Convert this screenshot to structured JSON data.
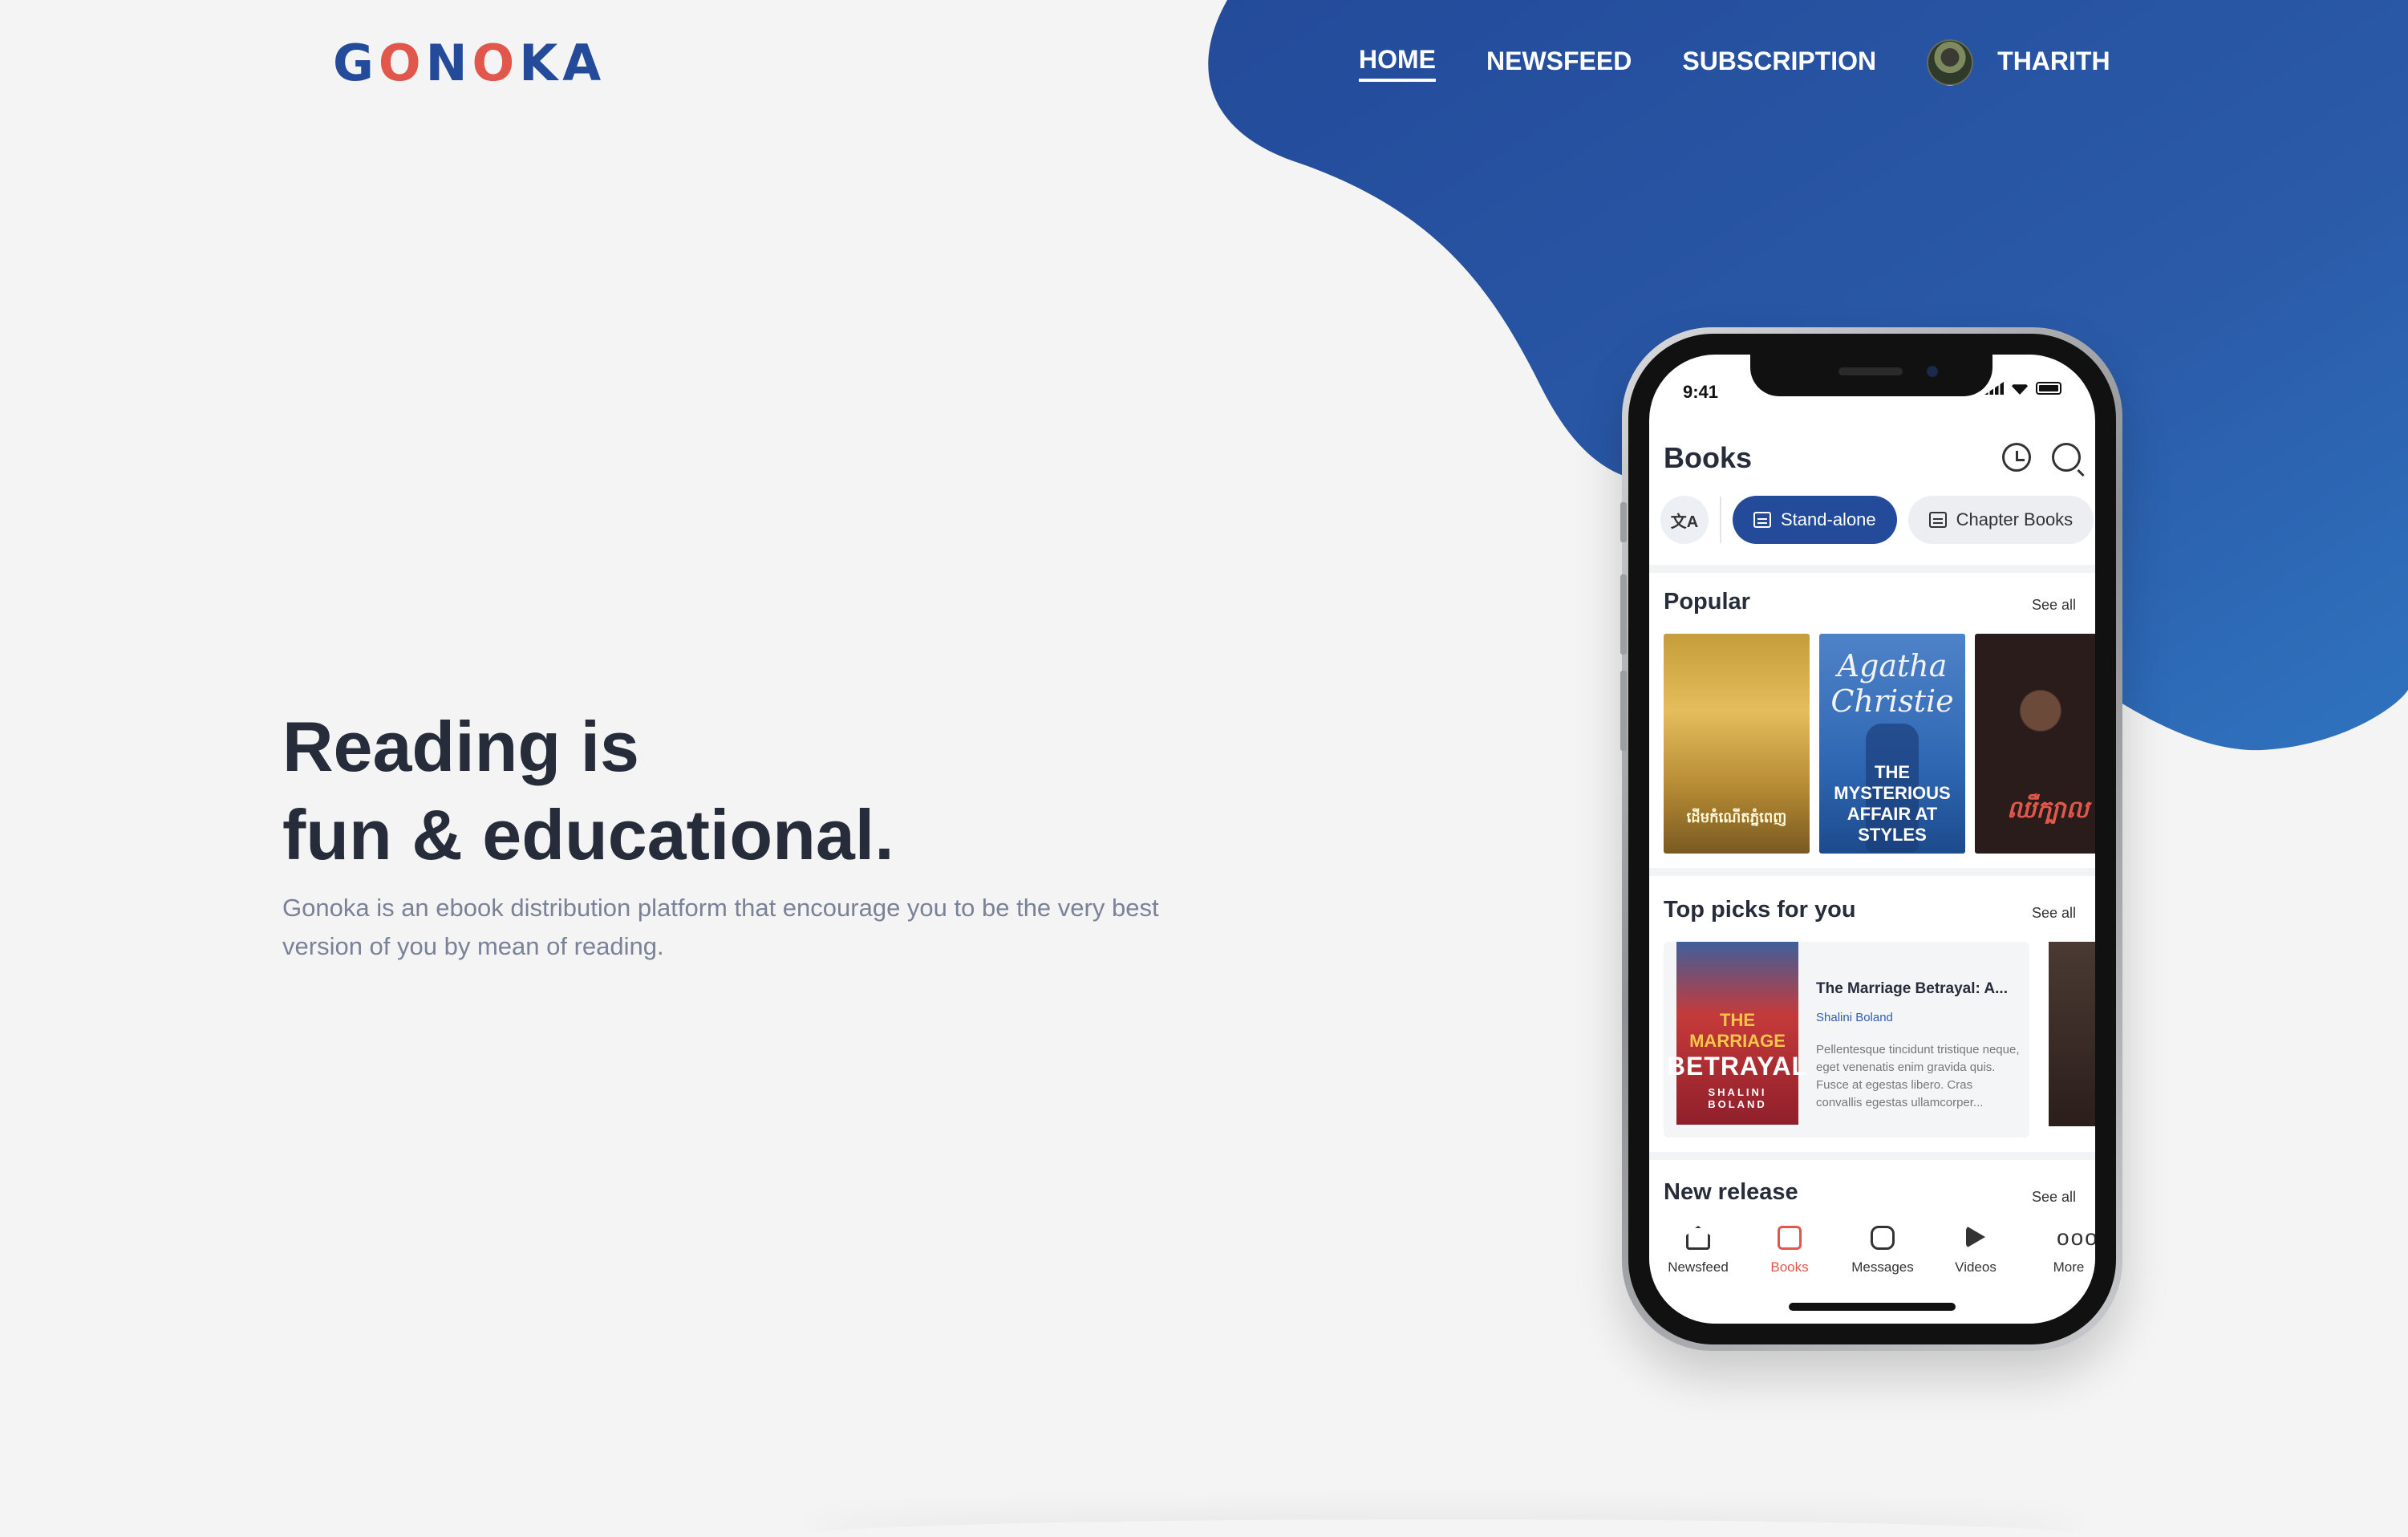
{
  "brand": {
    "logo": [
      "G",
      "O",
      "N",
      "O",
      "K",
      "A"
    ],
    "colors": {
      "primary": "#234b9a",
      "accent": "#e2574c",
      "background": "#f4f4f4",
      "text": "#262c3a",
      "muted": "#7a8297"
    }
  },
  "nav": {
    "home": "HOME",
    "newsfeed": "NEWSFEED",
    "subscription": "SUBSCRIPTION",
    "user_name": "THARITH",
    "user_avatar_icon": "avatar-photo"
  },
  "hero": {
    "title_line1": "Reading is",
    "title_line2": "fun & educational.",
    "description": "Gonoka is an ebook distribution platform that encourage you to be the very best version of you by mean of reading."
  },
  "phone": {
    "status": {
      "time": "9:41"
    },
    "header": {
      "title": "Books",
      "history_icon": "history-icon",
      "search_icon": "search-icon"
    },
    "chips": {
      "translate_icon": "translate-icon",
      "standalone": "Stand-alone",
      "chapter_books": "Chapter Books"
    },
    "popular": {
      "title": "Popular",
      "see_all": "See all",
      "books": [
        {
          "cover_text": "ដើមកំណើតភ្នំពេញ"
        },
        {
          "script": "Agatha Christie",
          "cover_text": "THE MYSTERIOUS AFFAIR AT STYLES"
        },
        {
          "cover_text": "ឈឺក្បាល"
        }
      ]
    },
    "top_picks": {
      "title": "Top picks for you",
      "see_all": "See all",
      "card": {
        "cover_line1": "THE MARRIAGE",
        "cover_line2": "BETRAYAL",
        "cover_author": "SHALINI BOLAND",
        "title": "The Marriage Betrayal: A...",
        "author": "Shalini Boland",
        "description": "Pellentesque tincidunt tristique neque, eget venenatis enim gravida quis. Fusce at egestas libero. Cras convallis egestas ullamcorper..."
      }
    },
    "new_release": {
      "title": "New release",
      "see_all": "See all"
    },
    "tabs": {
      "newsfeed": "Newsfeed",
      "books": "Books",
      "messages": "Messages",
      "videos": "Videos",
      "more": "More",
      "more_glyph": "ooo"
    }
  }
}
